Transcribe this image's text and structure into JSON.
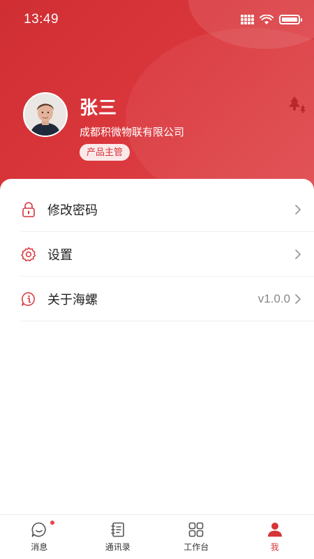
{
  "status_bar": {
    "time": "13:49"
  },
  "profile": {
    "name": "张三",
    "company": "成都积微物联有限公司",
    "role": "产品主管"
  },
  "menu": [
    {
      "label": "修改密码",
      "icon": "lock-icon",
      "value": ""
    },
    {
      "label": "设置",
      "icon": "gear-icon",
      "value": ""
    },
    {
      "label": "关于海螺",
      "icon": "info-icon",
      "value": "v1.0.0"
    }
  ],
  "bottom_nav": [
    {
      "label": "消息",
      "icon": "chat-icon",
      "active": false,
      "badge": true
    },
    {
      "label": "通讯录",
      "icon": "contacts-icon",
      "active": false
    },
    {
      "label": "工作台",
      "icon": "grid-icon",
      "active": false
    },
    {
      "label": "我",
      "icon": "user-icon",
      "active": true
    }
  ],
  "colors": {
    "brand": "#d6353a",
    "header": "#cf2e33"
  }
}
